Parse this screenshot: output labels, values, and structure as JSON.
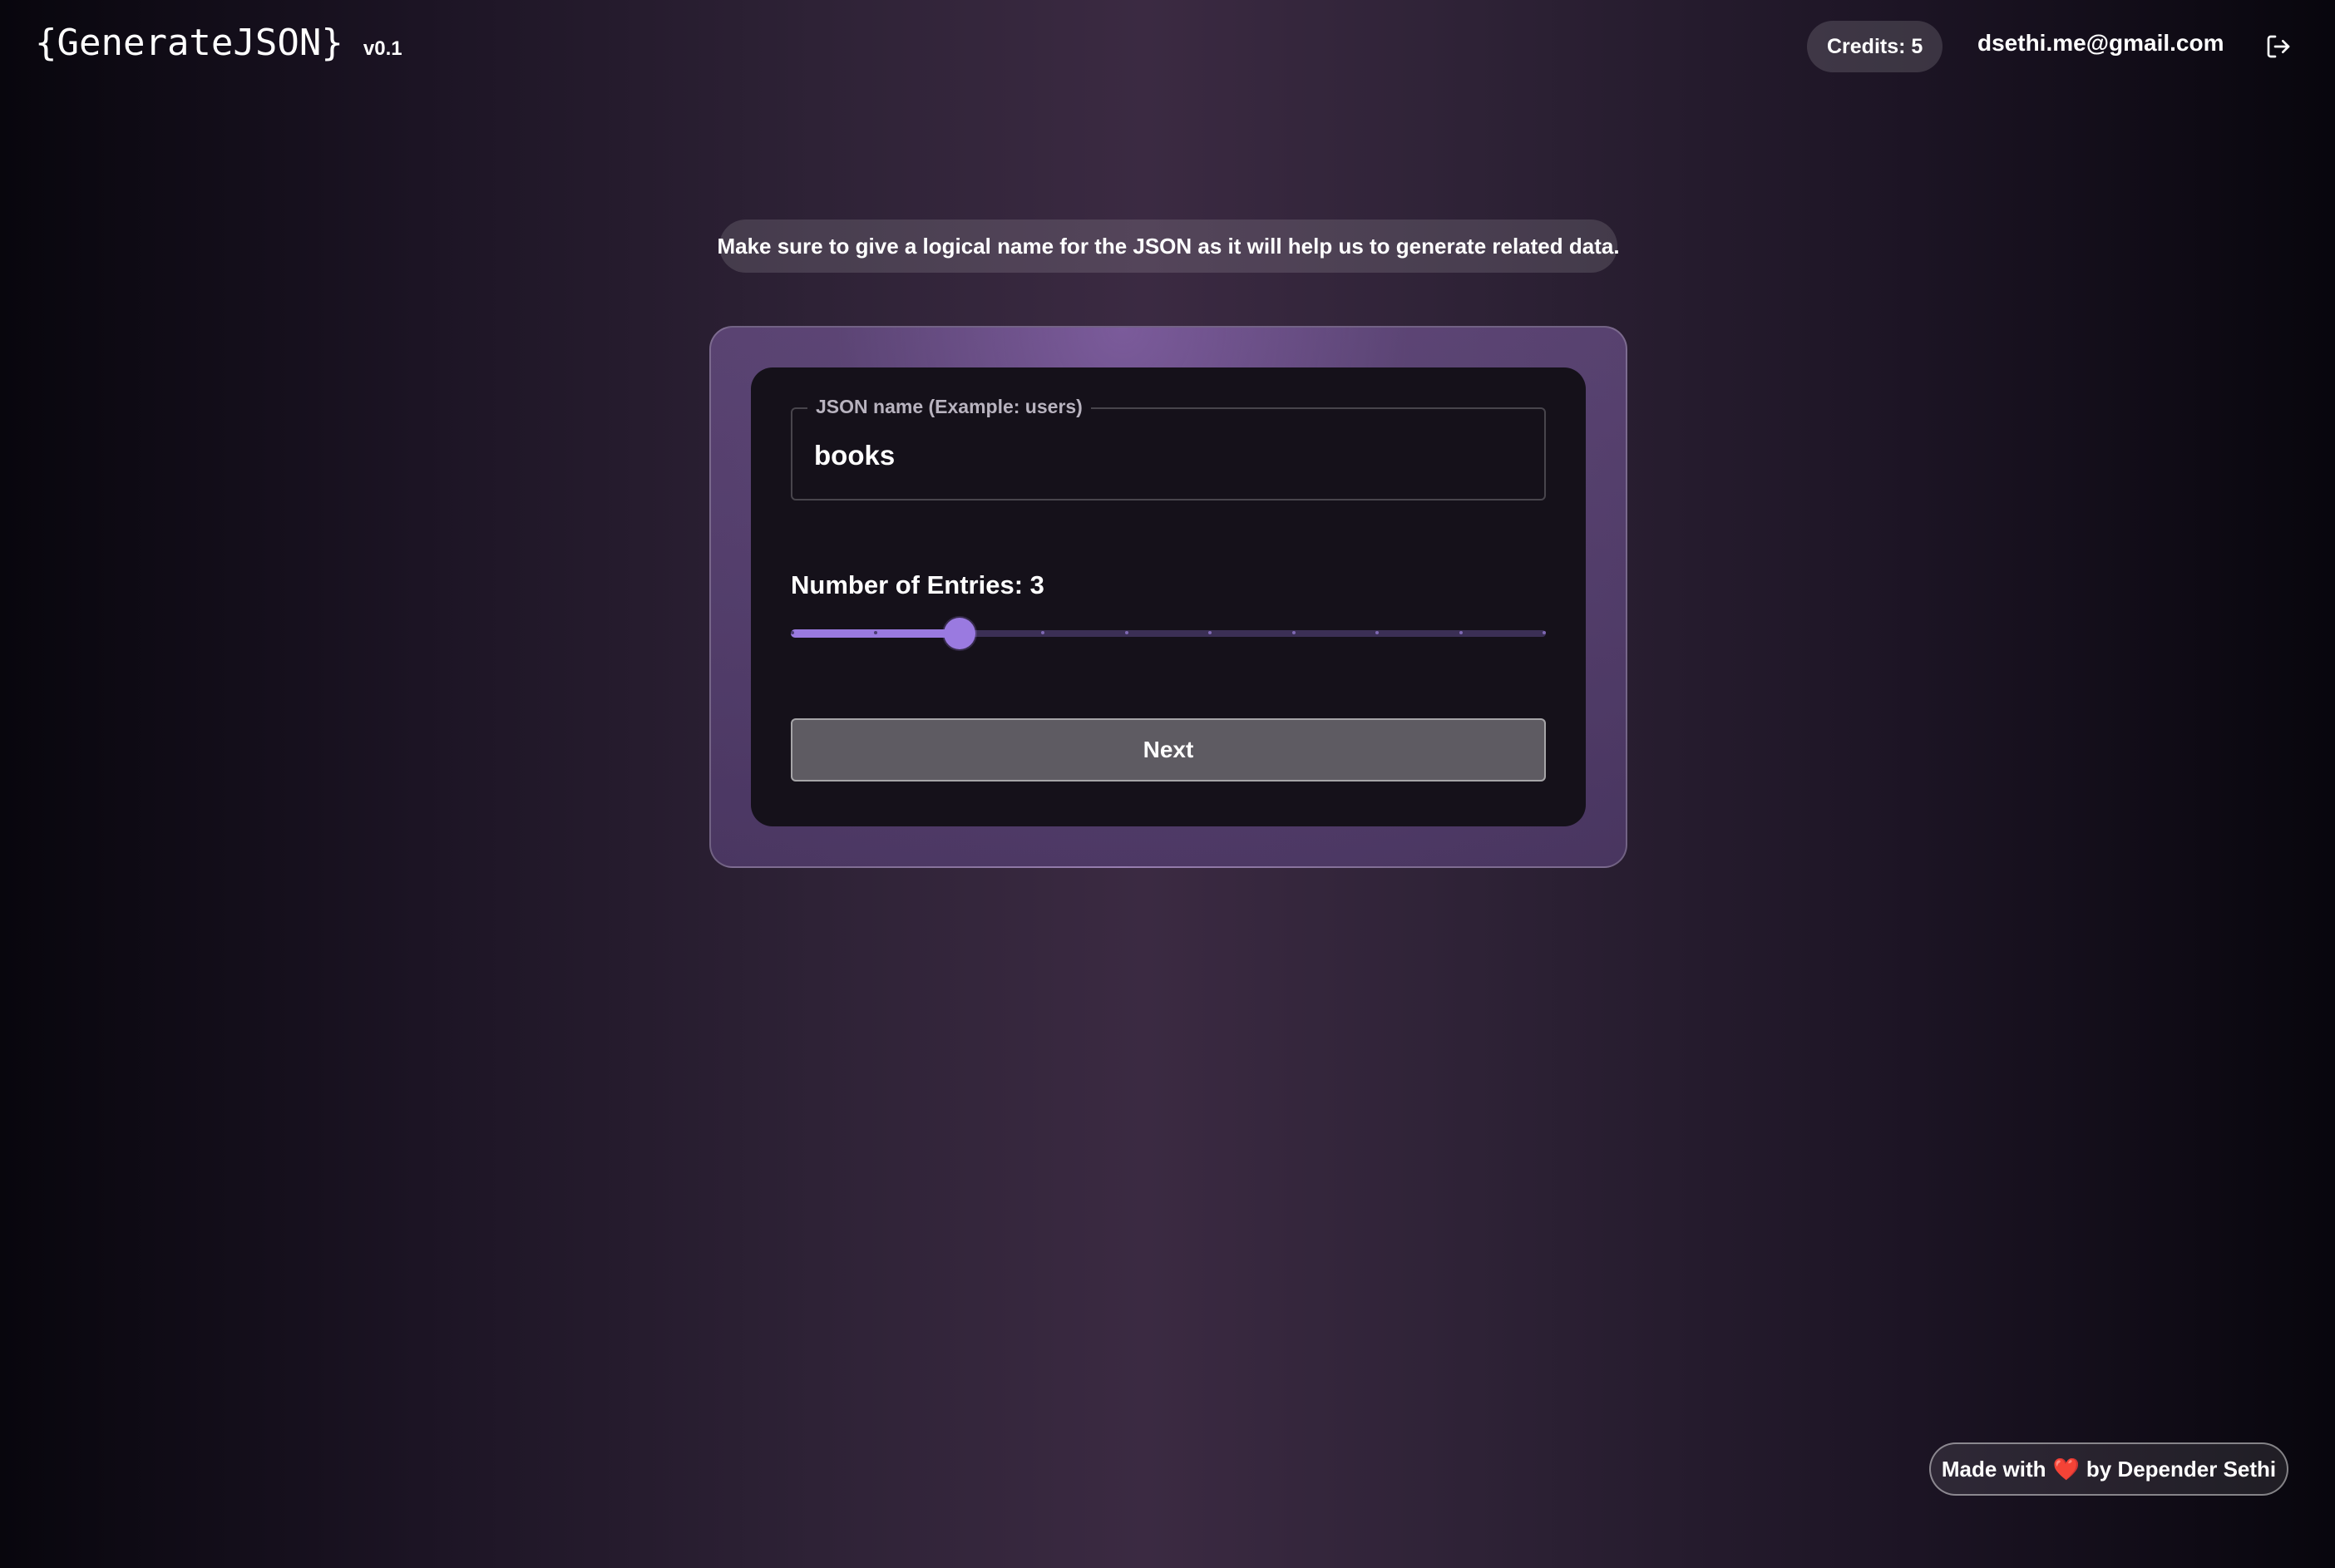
{
  "header": {
    "brand_title": "{GenerateJSON}",
    "brand_version": "v0.1",
    "credits": "Credits: 5",
    "user_email": "dsethi.me@gmail.com",
    "logout_icon": "logout-icon"
  },
  "hint": "Make sure to give a logical name for the JSON as it will help us to generate related data.",
  "form": {
    "json_name_label": "JSON name (Example: users)",
    "json_name_value": "books",
    "entries_label": "Number of Entries: 3",
    "entries_value": 3,
    "entries_min": 1,
    "entries_max": 10,
    "next_label": "Next"
  },
  "footer": {
    "made_with_prefix": "Made with",
    "heart": "❤️",
    "made_with_suffix": "by Depender Sethi"
  },
  "colors": {
    "accent": "#9a7ae0",
    "button_bg": "#5e5b62",
    "card_inner_bg": "#15111a"
  }
}
